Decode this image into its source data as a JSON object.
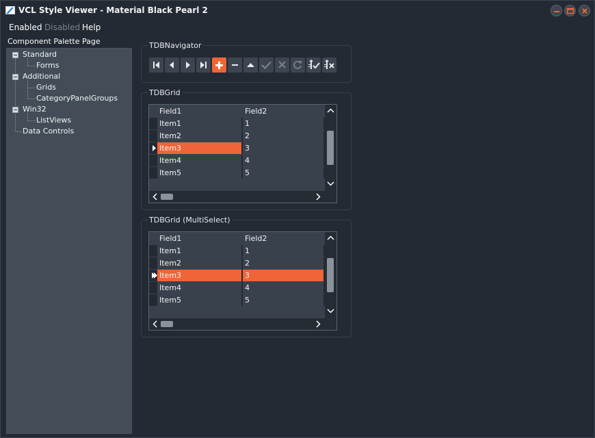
{
  "window": {
    "title": "VCL Style Viewer - Material Black Pearl 2"
  },
  "menu": {
    "items": [
      "Enabled",
      "Disabled",
      "Help"
    ]
  },
  "palette": {
    "label": "Component Palette Page",
    "tree": [
      {
        "label": "Standard",
        "children": [
          "Forms"
        ]
      },
      {
        "label": "Additional",
        "children": [
          "Grids",
          "CategoryPanelGroups"
        ]
      },
      {
        "label": "Win32",
        "children": [
          "ListViews"
        ]
      },
      {
        "label": "Data Controls",
        "children": []
      }
    ]
  },
  "navigator": {
    "label": "TDBNavigator",
    "buttons": [
      "first-icon",
      "prior-icon",
      "next-icon",
      "last-icon",
      "insert-icon",
      "delete-icon",
      "edit-icon",
      "post-icon",
      "cancel-icon",
      "refresh-icon",
      "apply-updates-icon",
      "cancel-updates-icon"
    ]
  },
  "grid1": {
    "label": "TDBGrid",
    "columns": [
      "Field1",
      "Field2"
    ],
    "rows": [
      [
        "Item1",
        "1"
      ],
      [
        "Item2",
        "2"
      ],
      [
        "Item3",
        "3"
      ],
      [
        "Item4",
        "4"
      ],
      [
        "Item5",
        "5"
      ]
    ],
    "current_row": 2
  },
  "grid2": {
    "label": "TDBGrid (MultiSelect)",
    "columns": [
      "Field1",
      "Field2"
    ],
    "rows": [
      [
        "Item1",
        "1"
      ],
      [
        "Item2",
        "2"
      ],
      [
        "Item3",
        "3"
      ],
      [
        "Item4",
        "4"
      ],
      [
        "Item5",
        "5"
      ]
    ],
    "current_row": 2
  },
  "colors": {
    "accent": "#ef6537",
    "background": "#232a33",
    "panel": "#434d57",
    "grid_row": "#39424c"
  }
}
